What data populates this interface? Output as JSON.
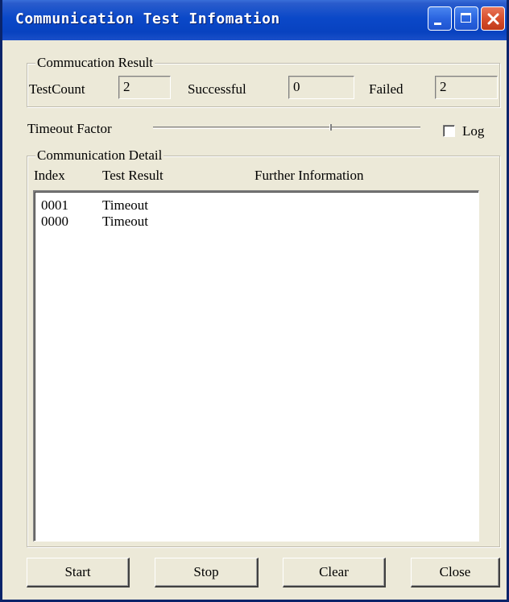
{
  "window": {
    "title": "Communication Test Infomation"
  },
  "result_group": {
    "title": "Commucation Result",
    "test_count_label": "TestCount",
    "test_count_value": "2",
    "successful_label": "Successful",
    "successful_value": "0",
    "failed_label": "Failed",
    "failed_value": "2"
  },
  "timeout": {
    "label": "Timeout Factor",
    "slider_position": 0.66
  },
  "log": {
    "label": "Log",
    "checked": false
  },
  "detail_group": {
    "title": "Communication Detail",
    "columns": [
      "Index",
      "Test Result",
      "Further Information"
    ],
    "rows": [
      {
        "index": "0001",
        "result": "Timeout",
        "info": ""
      },
      {
        "index": "0000",
        "result": "Timeout",
        "info": ""
      }
    ]
  },
  "buttons": {
    "start": "Start",
    "stop": "Stop",
    "clear": "Clear",
    "close": "Close"
  },
  "colors": {
    "titlebar": "#0842c0",
    "dialog_bg": "#ece9d8",
    "close_button": "#d8502e"
  },
  "icons": {
    "minimize": "minimize-icon",
    "maximize": "maximize-icon",
    "close": "close-icon"
  }
}
